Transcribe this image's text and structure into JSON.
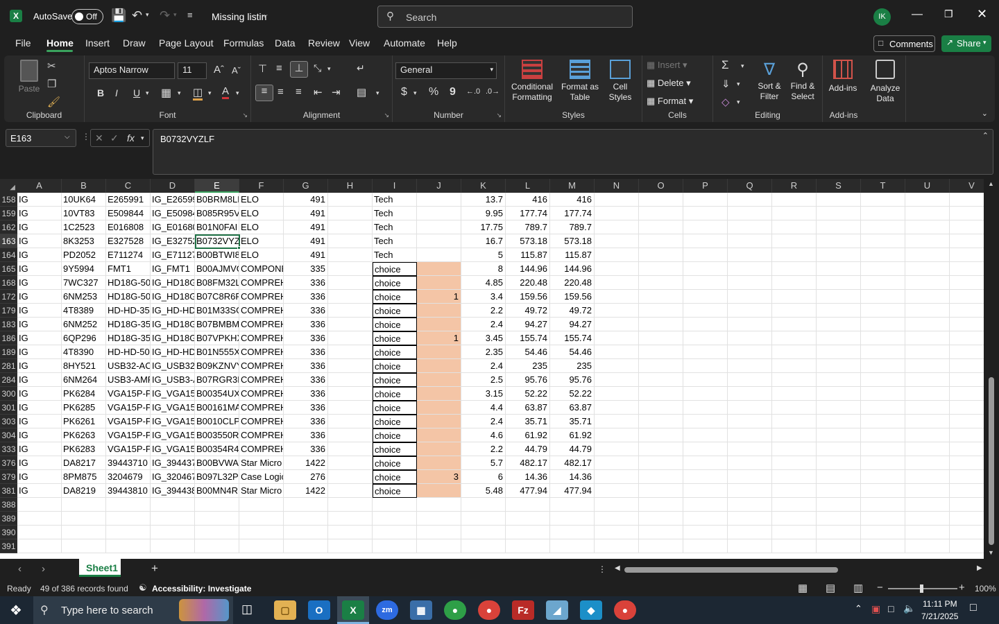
{
  "title": {
    "autosave_label": "AutoSave",
    "autosave_state": "Off",
    "doc_name": "Missing listin",
    "search_placeholder": "Search",
    "user_initials": "IK"
  },
  "menu": [
    "File",
    "Home",
    "Insert",
    "Draw",
    "Page Layout",
    "Formulas",
    "Data",
    "Review",
    "View",
    "Automate",
    "Help"
  ],
  "actions": {
    "comments": "Comments",
    "share": "Share"
  },
  "ribbon": {
    "clipboard": {
      "paste": "Paste",
      "label": "Clipboard"
    },
    "font": {
      "name": "Aptos Narrow",
      "size": "11",
      "label": "Font",
      "bold": "B",
      "italic": "I",
      "underline": "U"
    },
    "alignment": {
      "label": "Alignment"
    },
    "number": {
      "format": "General",
      "label": "Number",
      "currency": "$",
      "percent": "%",
      "comma": "9"
    },
    "styles": {
      "conditional": "Conditional Formatting",
      "format_table": "Format as Table",
      "cell_styles": "Cell Styles",
      "label": "Styles"
    },
    "cells": {
      "insert": "Insert",
      "delete": "Delete",
      "format": "Format",
      "label": "Cells"
    },
    "editing": {
      "sort": "Sort & Filter",
      "find": "Find & Select",
      "label": "Editing",
      "sum": "Σ"
    },
    "addins": {
      "addins": "Add-ins",
      "analyze": "Analyze Data",
      "label": "Add-ins"
    }
  },
  "formula": {
    "name_box": "E163",
    "value": "B0732VYZLF",
    "fx": "fx"
  },
  "columns": [
    "A",
    "B",
    "C",
    "D",
    "E",
    "F",
    "G",
    "H",
    "I",
    "J",
    "K",
    "L",
    "M",
    "N",
    "O",
    "P",
    "Q",
    "R",
    "S",
    "T",
    "U",
    "V"
  ],
  "rows": [
    {
      "n": "158",
      "A": "IG",
      "B": "10UK64",
      "C": "E265991",
      "D": "IG_E26599",
      "E": "B0BRM8LK",
      "F": "ELO",
      "G": "491",
      "I": "Tech",
      "J": "",
      "K": "13.7",
      "L": "416",
      "M": "416"
    },
    {
      "n": "159",
      "A": "IG",
      "B": "10VT83",
      "C": "E509844",
      "D": "IG_E50984",
      "E": "B085R95V",
      "F": "ELO",
      "G": "491",
      "I": "Tech",
      "J": "",
      "K": "9.95",
      "L": "177.74",
      "M": "177.74"
    },
    {
      "n": "162",
      "A": "IG",
      "B": "1C2523",
      "C": "E016808",
      "D": "IG_E01680",
      "E": "B01N0FAI",
      "F": "ELO",
      "G": "491",
      "I": "Tech",
      "J": "",
      "K": "17.75",
      "L": "789.7",
      "M": "789.7"
    },
    {
      "n": "163",
      "A": "IG",
      "B": "8K3253",
      "C": "E327528",
      "D": "IG_E32752",
      "E": "B0732VYZ",
      "F": "ELO",
      "G": "491",
      "I": "Tech",
      "J": "",
      "K": "16.7",
      "L": "573.18",
      "M": "573.18"
    },
    {
      "n": "164",
      "A": "IG",
      "B": "PD2052",
      "C": "E711274",
      "D": "IG_E71127",
      "E": "B00BTWI8",
      "F": "ELO",
      "G": "491",
      "I": "Tech",
      "J": "",
      "K": "5",
      "L": "115.87",
      "M": "115.87"
    },
    {
      "n": "165",
      "A": "IG",
      "B": "9Y5994",
      "C": "FMT1",
      "D": "IG_FMT1",
      "E": "B00AJMVG",
      "F": "COMPONE",
      "G": "335",
      "I": "choice",
      "J": "",
      "K": "8",
      "L": "144.96",
      "M": "144.96"
    },
    {
      "n": "168",
      "A": "IG",
      "B": "7WC327",
      "C": "HD18G-50",
      "D": "IG_HD18G",
      "E": "B08FM32L",
      "F": "COMPREH",
      "G": "336",
      "I": "choice",
      "J": "",
      "K": "4.85",
      "L": "220.48",
      "M": "220.48"
    },
    {
      "n": "172",
      "A": "IG",
      "B": "6NM253",
      "C": "HD18G-50",
      "D": "IG_HD18G",
      "E": "B07C8R6P",
      "F": "COMPREH",
      "G": "336",
      "I": "choice",
      "J": "1",
      "K": "3.4",
      "L": "159.56",
      "M": "159.56"
    },
    {
      "n": "179",
      "A": "IG",
      "B": "4T8389",
      "C": "HD-HD-35",
      "D": "IG_HD-HD",
      "E": "B01M33SG",
      "F": "COMPREH",
      "G": "336",
      "I": "choice",
      "J": "",
      "K": "2.2",
      "L": "49.72",
      "M": "49.72"
    },
    {
      "n": "183",
      "A": "IG",
      "B": "6NM252",
      "C": "HD18G-35",
      "D": "IG_HD18G",
      "E": "B07BMBM",
      "F": "COMPREH",
      "G": "336",
      "I": "choice",
      "J": "",
      "K": "2.4",
      "L": "94.27",
      "M": "94.27"
    },
    {
      "n": "186",
      "A": "IG",
      "B": "6QP296",
      "C": "HD18G-35",
      "D": "IG_HD18G",
      "E": "B07VPKHX",
      "F": "COMPREH",
      "G": "336",
      "I": "choice",
      "J": "1",
      "K": "3.45",
      "L": "155.74",
      "M": "155.74"
    },
    {
      "n": "189",
      "A": "IG",
      "B": "4T8390",
      "C": "HD-HD-50",
      "D": "IG_HD-HD",
      "E": "B01N555X",
      "F": "COMPREH",
      "G": "336",
      "I": "choice",
      "J": "",
      "K": "2.35",
      "L": "54.46",
      "M": "54.46"
    },
    {
      "n": "281",
      "A": "IG",
      "B": "8HY521",
      "C": "USB32-AC",
      "D": "IG_USB32-",
      "E": "B09KZNVY",
      "F": "COMPREH",
      "G": "336",
      "I": "choice",
      "J": "",
      "K": "2.4",
      "L": "235",
      "M": "235"
    },
    {
      "n": "284",
      "A": "IG",
      "B": "6NM264",
      "C": "USB3-AMF",
      "D": "IG_USB3-A",
      "E": "B07RGR3R",
      "F": "COMPREH",
      "G": "336",
      "I": "choice",
      "J": "",
      "K": "2.5",
      "L": "95.76",
      "M": "95.76"
    },
    {
      "n": "300",
      "A": "IG",
      "B": "PK6284",
      "C": "VGA15P-P",
      "D": "IG_VGA15I",
      "E": "B00354UX",
      "F": "COMPREH",
      "G": "336",
      "I": "choice",
      "J": "",
      "K": "3.15",
      "L": "52.22",
      "M": "52.22"
    },
    {
      "n": "301",
      "A": "IG",
      "B": "PK6285",
      "C": "VGA15P-P",
      "D": "IG_VGA15I",
      "E": "B00161MA",
      "F": "COMPREH",
      "G": "336",
      "I": "choice",
      "J": "",
      "K": "4.4",
      "L": "63.87",
      "M": "63.87"
    },
    {
      "n": "303",
      "A": "IG",
      "B": "PK6261",
      "C": "VGA15P-P",
      "D": "IG_VGA15I",
      "E": "B0010CLP",
      "F": "COMPREH",
      "G": "336",
      "I": "choice",
      "J": "",
      "K": "2.4",
      "L": "35.71",
      "M": "35.71"
    },
    {
      "n": "304",
      "A": "IG",
      "B": "PK6263",
      "C": "VGA15P-P",
      "D": "IG_VGA15I",
      "E": "B003550R",
      "F": "COMPREH",
      "G": "336",
      "I": "choice",
      "J": "",
      "K": "4.6",
      "L": "61.92",
      "M": "61.92"
    },
    {
      "n": "333",
      "A": "IG",
      "B": "PK6283",
      "C": "VGA15P-P",
      "D": "IG_VGA15I",
      "E": "B00354R4",
      "F": "COMPREH",
      "G": "336",
      "I": "choice",
      "J": "",
      "K": "2.2",
      "L": "44.79",
      "M": "44.79"
    },
    {
      "n": "376",
      "A": "IG",
      "B": "DA8217",
      "C": "39443710",
      "D": "IG_394437",
      "E": "B00BVWA",
      "F": "Star Micro",
      "G": "1422",
      "I": "choice",
      "J": "",
      "K": "5.7",
      "L": "482.17",
      "M": "482.17"
    },
    {
      "n": "379",
      "A": "IG",
      "B": "8PM875",
      "C": "3204679",
      "D": "IG_320467",
      "E": "B097L32P",
      "F": "Case Logic",
      "G": "276",
      "I": "choice",
      "J": "3",
      "K": "6",
      "L": "14.36",
      "M": "14.36"
    },
    {
      "n": "381",
      "A": "IG",
      "B": "DA8219",
      "C": "39443810",
      "D": "IG_394438",
      "E": "B00MN4R",
      "F": "Star Micro",
      "G": "1422",
      "I": "choice",
      "J": "",
      "K": "5.48",
      "L": "477.94",
      "M": "477.94"
    },
    {
      "n": "388"
    },
    {
      "n": "389"
    },
    {
      "n": "390"
    },
    {
      "n": "391"
    }
  ],
  "sheet": {
    "tab": "Sheet1"
  },
  "status": {
    "ready": "Ready",
    "records": "49 of 386 records found",
    "accessibility": "Accessibility: Investigate",
    "zoom": "100%"
  },
  "taskbar": {
    "search_placeholder": "Type here to search",
    "time": "11:11 PM",
    "date": "7/21/2025"
  },
  "colors": {
    "accent": "#1a7f45",
    "fill_j": "#f4c5a6",
    "selection": "#1e7145"
  }
}
